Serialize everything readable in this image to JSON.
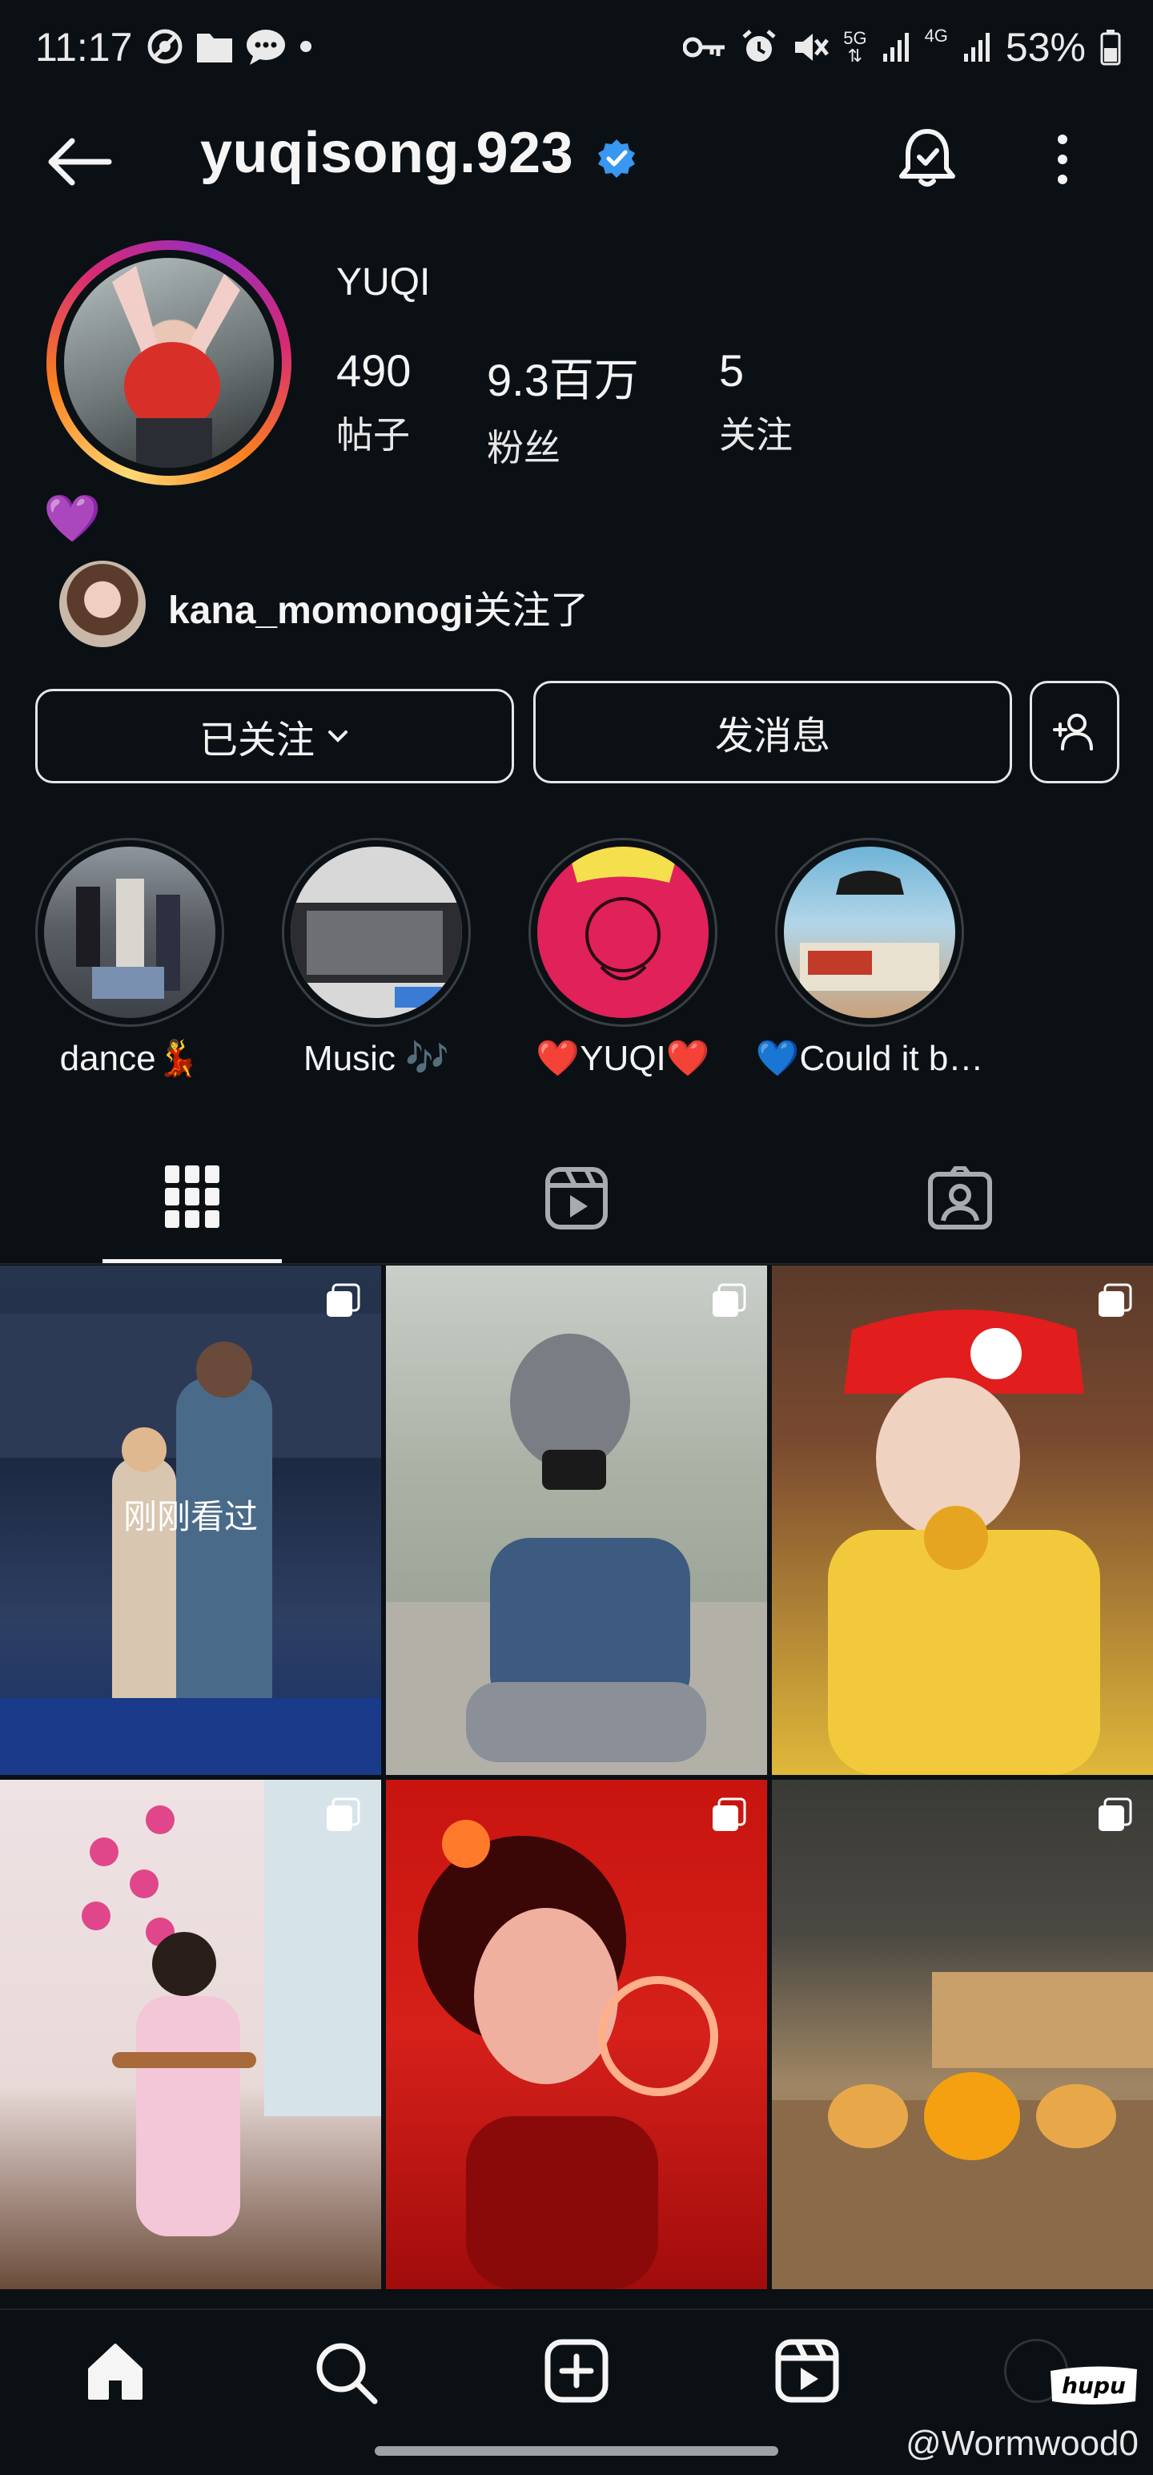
{
  "status_bar": {
    "time": "11:17",
    "battery": "53%",
    "network_5g": "5G",
    "network_4g": "4G"
  },
  "header": {
    "username": "yuqisong.923",
    "verified": true
  },
  "profile": {
    "display_name": "YUQI",
    "stats": [
      {
        "value": "490",
        "label": "帖子"
      },
      {
        "value": "9.3百万",
        "label": "粉丝"
      },
      {
        "value": "5",
        "label": "关注"
      }
    ],
    "bio_emoji": "💜",
    "followed_by_user": "kana_momonogi",
    "followed_by_suffix": "关注了"
  },
  "actions": {
    "following_label": "已关注",
    "message_label": "发消息"
  },
  "highlights": [
    {
      "label": "dance💃"
    },
    {
      "label": "Music 🎶"
    },
    {
      "label": "❤️YUQI❤️"
    },
    {
      "label": "💙Could it b…"
    }
  ],
  "grid": {
    "recently_viewed_label": "刚刚看过"
  },
  "watermark": {
    "user": "@Wormwood0",
    "brand": "hupu"
  },
  "colors": {
    "background": "#0b1014",
    "verified_blue": "#3897f0",
    "accent_ring": "#d62976"
  }
}
